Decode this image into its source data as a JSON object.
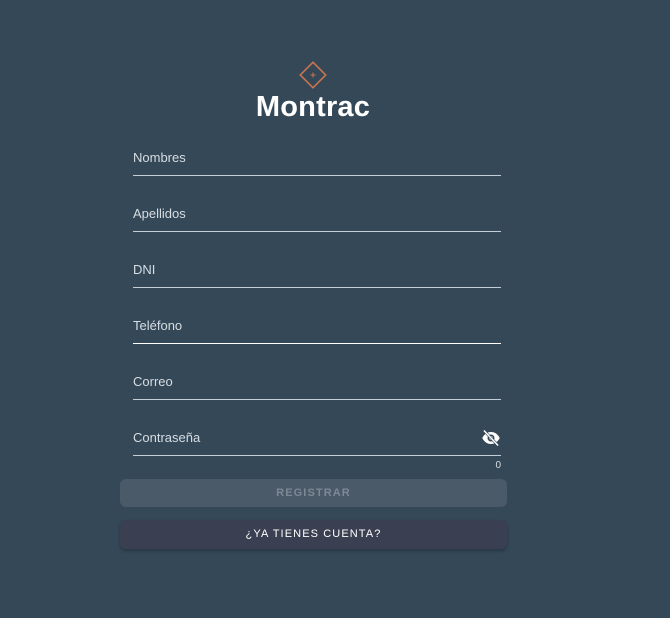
{
  "app": {
    "title": "Montrac"
  },
  "logo": {
    "icon": "diamond-plus-icon",
    "color": "#c8744f"
  },
  "form": {
    "fields": [
      {
        "label": "Nombres"
      },
      {
        "label": "Apellidos"
      },
      {
        "label": "DNI"
      },
      {
        "label": "Teléfono"
      },
      {
        "label": "Correo"
      },
      {
        "label": "Contraseña",
        "icon": "eye-off-icon",
        "counter": "0"
      }
    ]
  },
  "buttons": {
    "register_label": "REGISTRAR",
    "account_label": "¿YA TIENES CUENTA?"
  },
  "colors": {
    "background": "#344858",
    "register_button": "#4a5a69",
    "account_button": "#3b3f52"
  }
}
